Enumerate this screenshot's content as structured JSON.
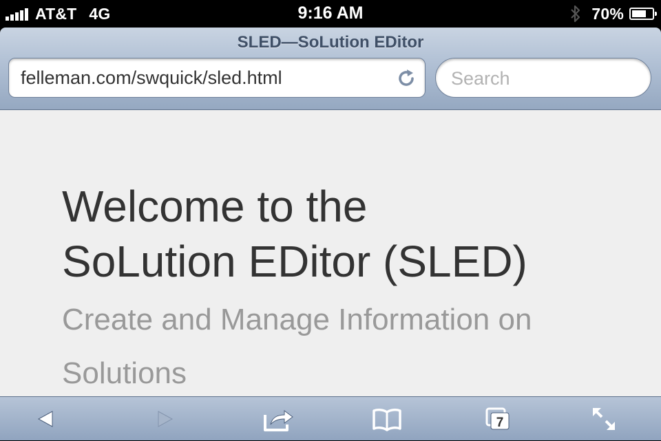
{
  "status_bar": {
    "carrier": "AT&T",
    "network": "4G",
    "time": "9:16 AM",
    "battery_text": "70%",
    "battery_level": 0.7,
    "signal_bars": 5
  },
  "browser": {
    "page_title": "SLED—SoLution EDitor",
    "url": "felleman.com/swquick/sled.html",
    "search_placeholder": "Search"
  },
  "page": {
    "heading_line1": "Welcome to the",
    "heading_line2": "SoLution EDitor (SLED)",
    "subheading": "Create and Manage Information on Solutions"
  },
  "toolbar": {
    "tab_count": "7",
    "back_enabled": true,
    "forward_enabled": false,
    "icons": [
      "back-arrow-icon",
      "forward-arrow-icon",
      "share-icon",
      "bookmarks-icon",
      "tabs-icon",
      "fullscreen-icon"
    ]
  },
  "colors": {
    "chrome_top": "#c9d4e2",
    "chrome_bottom": "#95a8c1",
    "title_text": "#3f4f66",
    "heading_text": "#333333",
    "subheading_text": "#999999",
    "page_background": "#efefef"
  }
}
